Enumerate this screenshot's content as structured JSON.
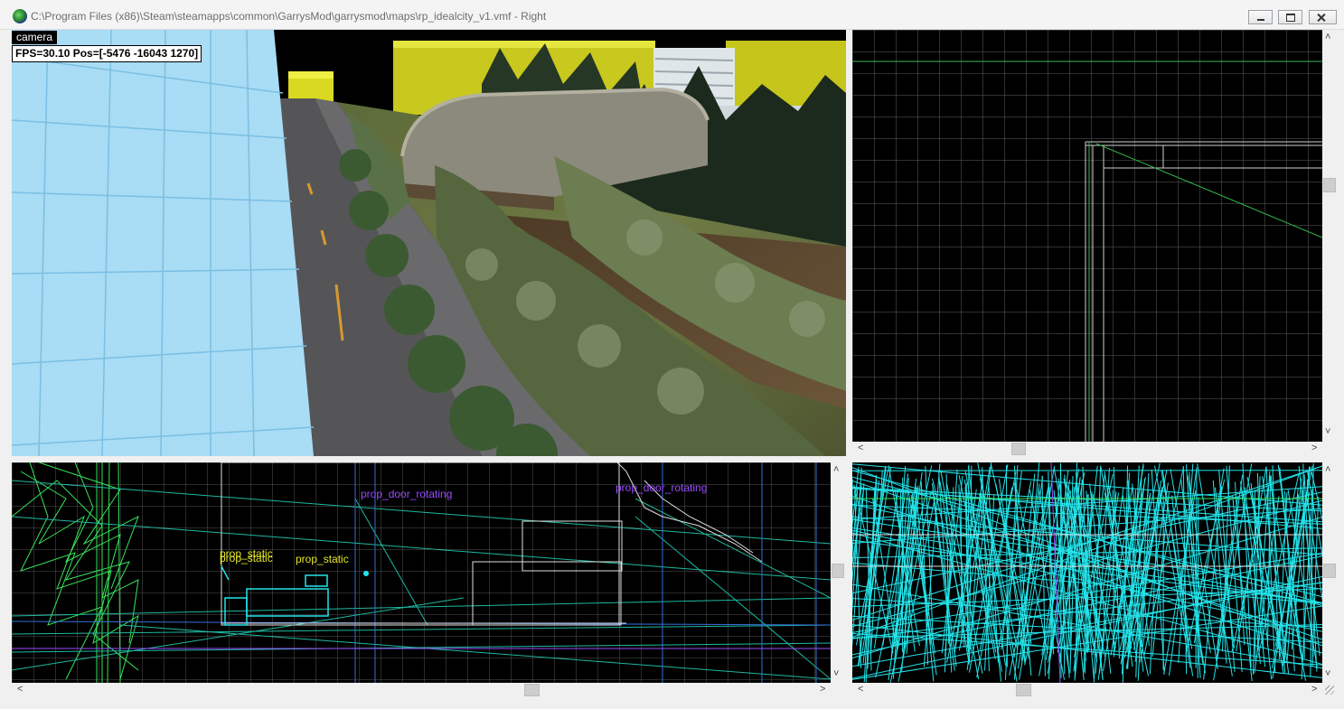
{
  "window": {
    "title": "C:\\Program Files (x86)\\Steam\\steamapps\\common\\GarrysMod\\garrysmod\\maps\\rp_idealcity_v1.vmf - Right",
    "minimize_glyph": "",
    "maximize_glyph": "",
    "close_glyph": ""
  },
  "camera_view": {
    "label": "camera",
    "stats": "FPS=30.10 Pos=[-5476 -16043 1270]"
  },
  "wireframe_view": {
    "entity_labels": [
      "prop_door_rotating",
      "prop_door_rotating",
      "prop_static",
      "prop_static",
      "prop_static"
    ]
  },
  "scroll_glyphs": {
    "up": "˄",
    "down": "˅",
    "left": "<",
    "right": ">"
  },
  "colors": {
    "wire_green": "#38e35a",
    "wire_cyan": "#24e4ea",
    "wire_teal": "#1fb8a0",
    "wire_purple": "#9b4cff",
    "grid": "#6d6d6d",
    "sky_wall": "#a9dcf5"
  }
}
